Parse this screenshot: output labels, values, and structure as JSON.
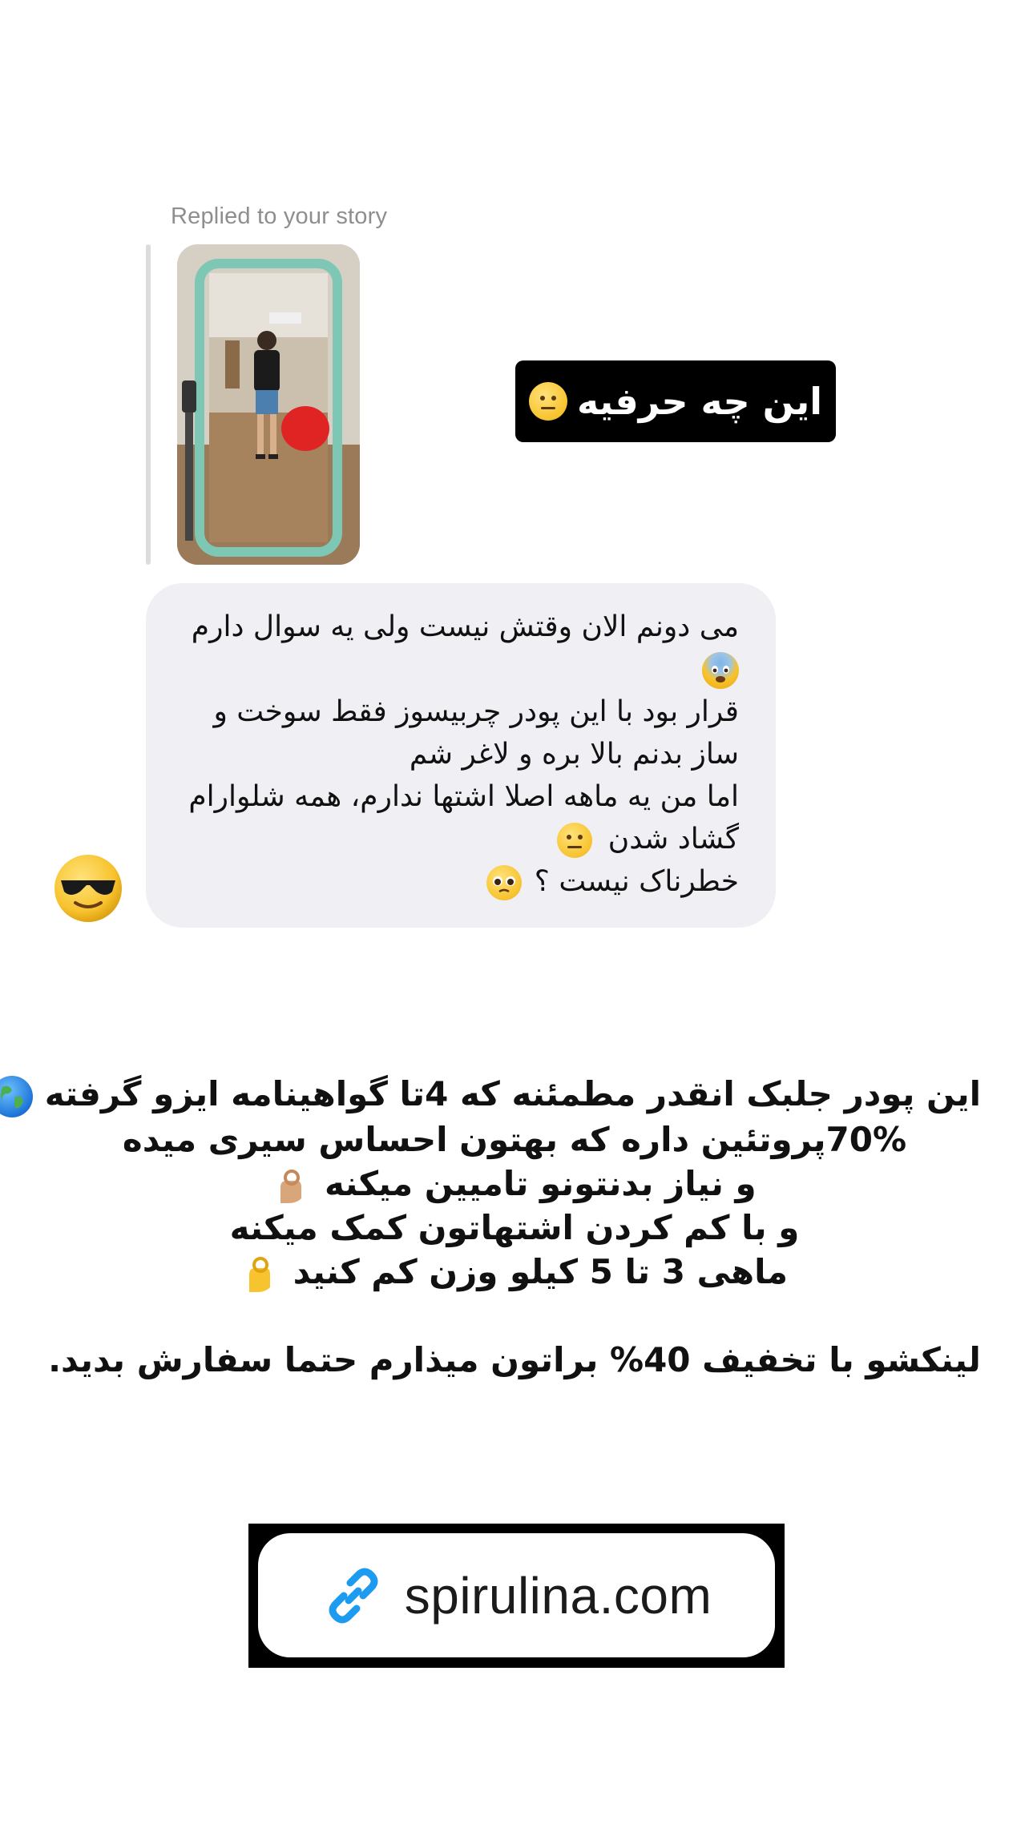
{
  "reply": {
    "label": "Replied to your story"
  },
  "story": {
    "sticker_text": "این چه حرفیه",
    "sticker_emoji": "neutral-face"
  },
  "message": {
    "lines": [
      "می دونم الان وقتش نیست ولی یه سوال دارم",
      "",
      "قرار بود با این پودر چربیسوز فقط سوخت و",
      "ساز بدنم بالا بره و لاغر شم",
      "اما من یه ماهه اصلا اشتها ندارم، همه شلوارام",
      "گشاد شدن",
      "خطرناک نیست ؟"
    ],
    "emojis": [
      "fearful-face",
      "neutral-face",
      "pleading-face"
    ]
  },
  "sender": {
    "avatar_emoji": "smiling-face-with-sunglasses"
  },
  "promo": {
    "lines": [
      "این پودر جلبک انقدر مطمئنه که 4تا گواهینامه ایزو گرفته",
      "70%پروتئین داره که بهتون احساس سیری میده",
      "و نیاز بدنتونو تامیین میکنه",
      "و  با کم کردن اشتهاتون کمک میکنه",
      "ماهی 3 تا 5 کیلو وزن کم کنید",
      "لینکشو با تخفیف 40% براتون میذارم حتما سفارش بدید."
    ],
    "emojis": [
      "globe-emoji",
      "ok-hand-emoji",
      "ok-hand-emoji"
    ]
  },
  "link_sticker": {
    "url_text": "spirulina.com",
    "icon": "link-icon",
    "icon_color": "#1d9bf0"
  },
  "colors": {
    "bubble_bg": "#efeff4",
    "sticker_bg": "#000000",
    "muted_text": "#8e8e8e"
  }
}
